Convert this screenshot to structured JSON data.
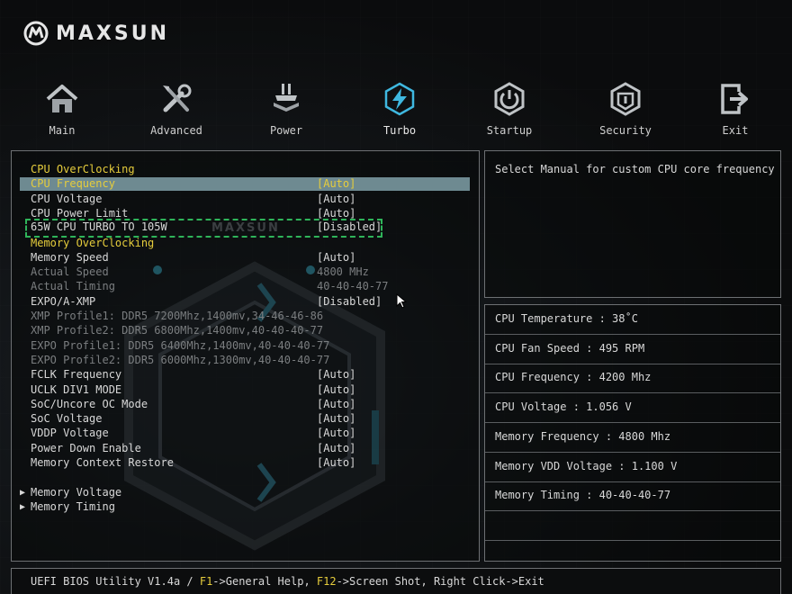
{
  "brand": {
    "name": "MAXSUN"
  },
  "nav": {
    "active": "Turbo",
    "items": [
      {
        "label": "Main",
        "icon": "home-icon"
      },
      {
        "label": "Advanced",
        "icon": "tools-icon"
      },
      {
        "label": "Power",
        "icon": "power-chip-icon"
      },
      {
        "label": "Turbo",
        "icon": "lightning-icon"
      },
      {
        "label": "Startup",
        "icon": "startup-icon"
      },
      {
        "label": "Security",
        "icon": "shield-icon"
      },
      {
        "label": "Exit",
        "icon": "exit-icon"
      }
    ]
  },
  "settings": {
    "watermark": "MAXSUN",
    "rows": [
      {
        "label": "CPU OverClocking",
        "value": "",
        "type": "header"
      },
      {
        "label": "CPU Frequency",
        "value": "[Auto]",
        "type": "selected"
      },
      {
        "label": "CPU Voltage",
        "value": "[Auto]",
        "type": "normal"
      },
      {
        "label": "CPU Power Limit",
        "value": "[Auto]",
        "type": "normal"
      },
      {
        "label": "65W CPU TURBO TO 105W",
        "value": "[Disabled]",
        "type": "dashed"
      },
      {
        "label": "Memory OverClocking",
        "value": "",
        "type": "header"
      },
      {
        "label": "Memory Speed",
        "value": "[Auto]",
        "type": "normal"
      },
      {
        "label": "Actual Speed",
        "value": "4800 MHz",
        "type": "disabled"
      },
      {
        "label": "Actual Timing",
        "value": "40-40-40-77",
        "type": "disabled"
      },
      {
        "label": "EXPO/A-XMP",
        "value": "[Disabled]",
        "type": "normal"
      },
      {
        "label": "XMP Profile1: DDR5 7200Mhz,1400mv,34-46-46-86",
        "value": "",
        "type": "disabled"
      },
      {
        "label": "XMP Profile2: DDR5 6800Mhz,1400mv,40-40-40-77",
        "value": "",
        "type": "disabled"
      },
      {
        "label": "EXPO Profile1: DDR5 6400Mhz,1400mv,40-40-40-77",
        "value": "",
        "type": "disabled"
      },
      {
        "label": "EXPO Profile2: DDR5 6000Mhz,1300mv,40-40-40-77",
        "value": "",
        "type": "disabled"
      },
      {
        "label": "FCLK Frequency",
        "value": "[Auto]",
        "type": "normal"
      },
      {
        "label": "UCLK DIV1 MODE",
        "value": "[Auto]",
        "type": "normal"
      },
      {
        "label": "SoC/Uncore OC Mode",
        "value": "[Auto]",
        "type": "normal"
      },
      {
        "label": "SoC Voltage",
        "value": "[Auto]",
        "type": "normal"
      },
      {
        "label": "VDDP Voltage",
        "value": "[Auto]",
        "type": "normal"
      },
      {
        "label": "Power Down Enable",
        "value": "[Auto]",
        "type": "normal"
      },
      {
        "label": "Memory Context Restore",
        "value": "[Auto]",
        "type": "normal"
      },
      {
        "label": "",
        "value": "",
        "type": "spacer"
      },
      {
        "label": "Memory Voltage",
        "value": "",
        "type": "sub"
      },
      {
        "label": "Memory Timing",
        "value": "",
        "type": "sub"
      }
    ]
  },
  "help": {
    "text": "Select Manual for custom CPU core frequency"
  },
  "info": {
    "items": [
      "CPU Temperature : 38˚C",
      "CPU Fan Speed : 495 RPM",
      "CPU Frequency : 4200 Mhz",
      "CPU Voltage : 1.056 V",
      "Memory Frequency : 4800 Mhz",
      "Memory VDD Voltage : 1.100 V",
      "Memory Timing : 40-40-40-77",
      "",
      ""
    ]
  },
  "footer": {
    "prefix": "UEFI BIOS Utility V1.4a / ",
    "key1": "F1",
    "text1": "->General Help, ",
    "key2": "F12",
    "text2": "->Screen Shot, Right Click->Exit"
  },
  "colors": {
    "accent": "#e6cd3c",
    "selected_bg": "#6e8a91",
    "turbo_icon": "#3fb8e0",
    "dashed_outline": "#2fb45a"
  }
}
